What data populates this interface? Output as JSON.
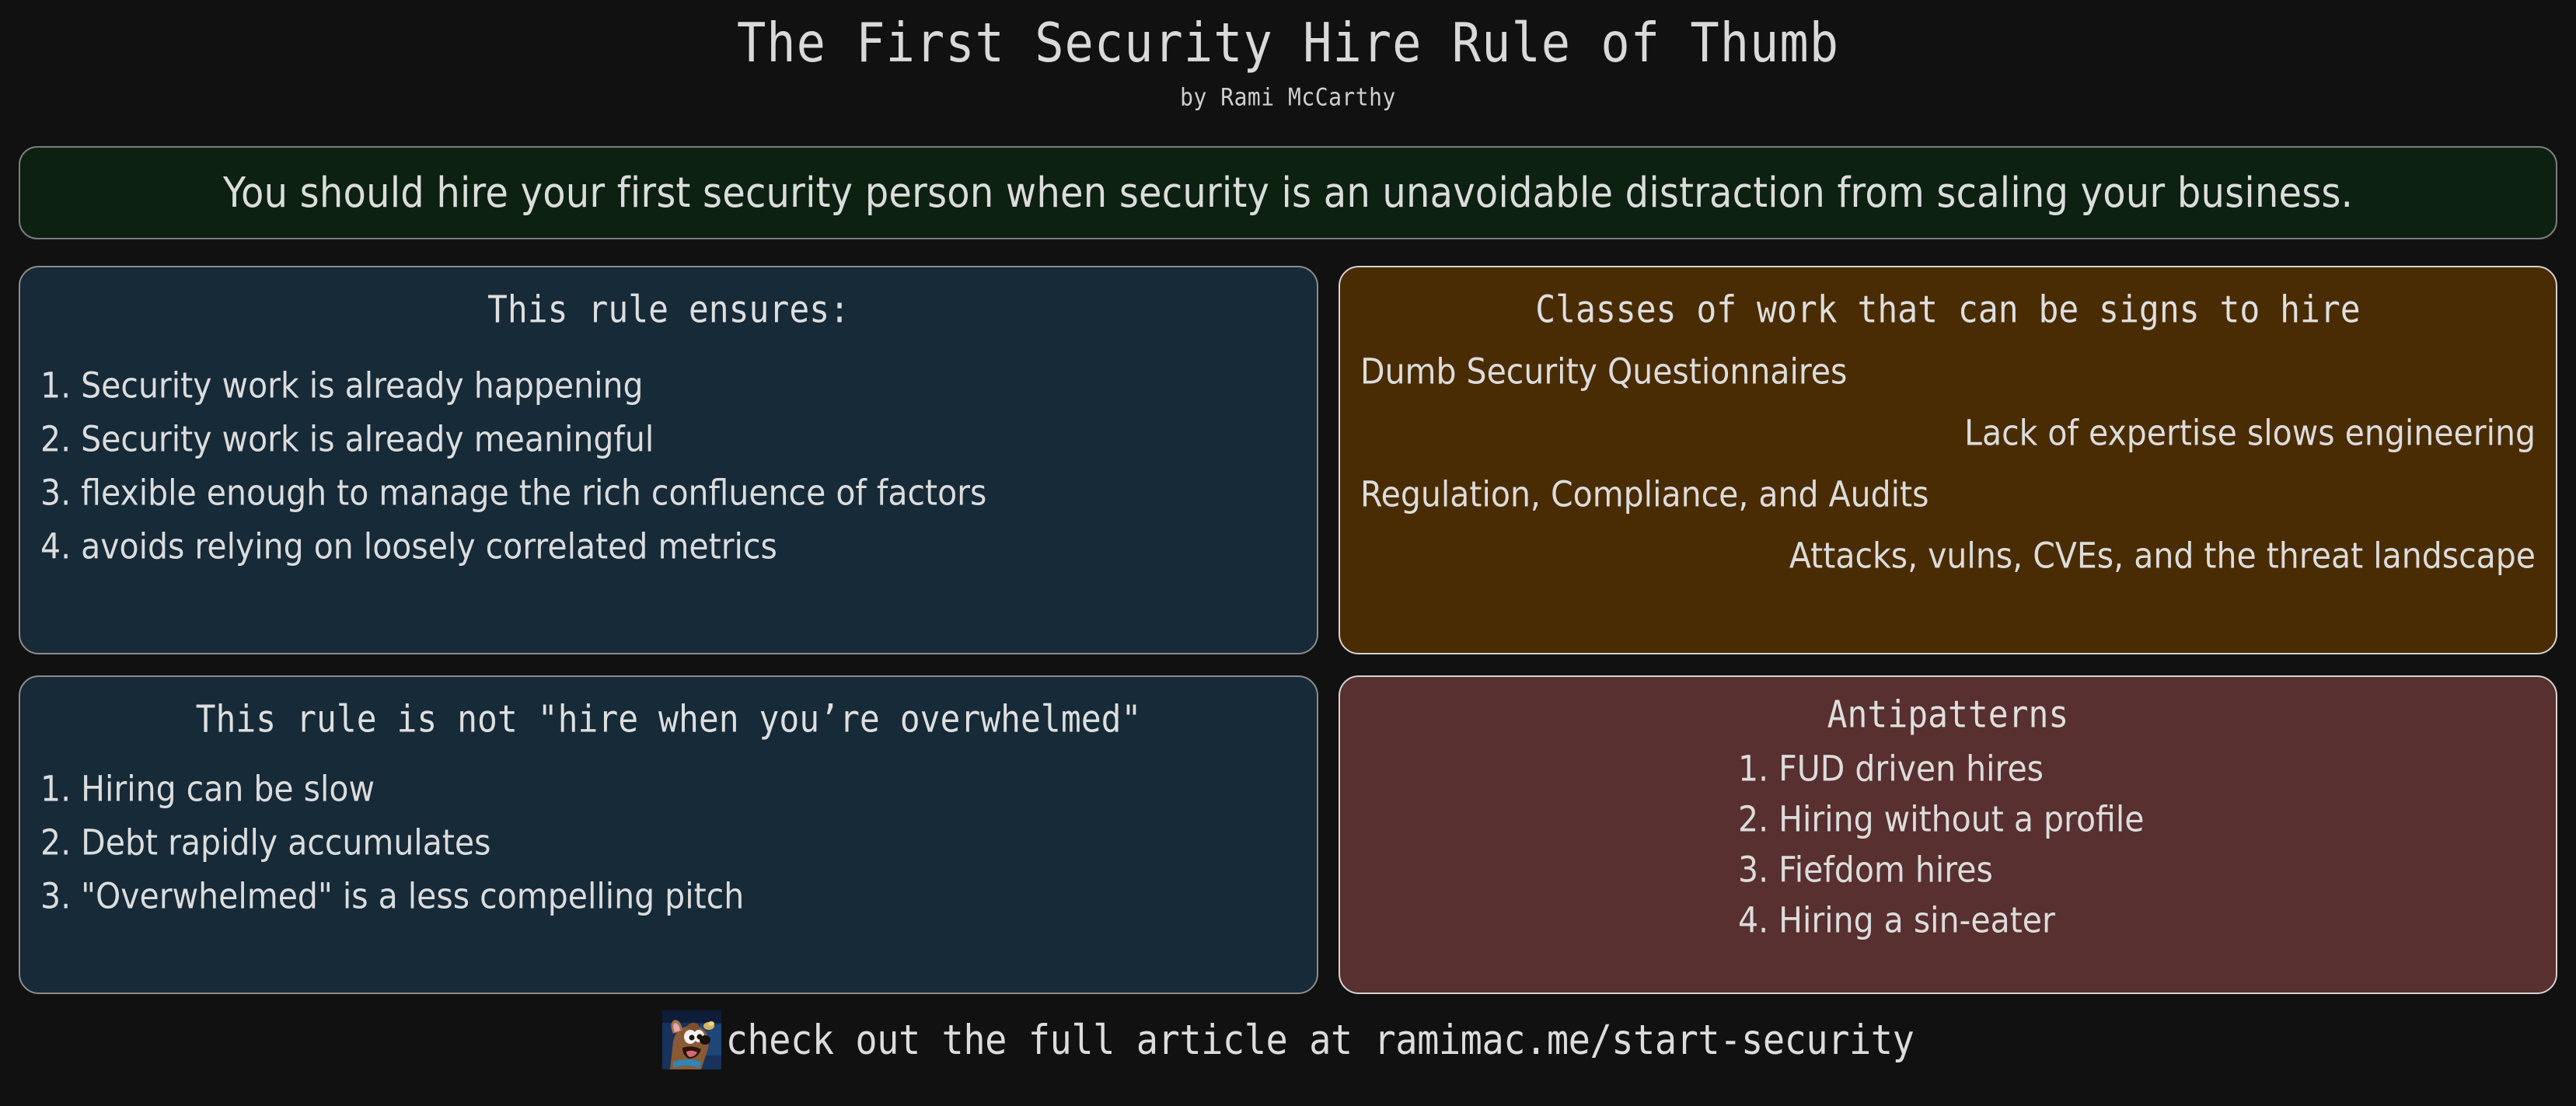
{
  "header": {
    "title": "The First Security Hire Rule of Thumb",
    "byline": "by Rami McCarthy"
  },
  "banner": {
    "text": "You should hire your first security person when security is an unavoidable distraction from scaling your business.",
    "background_color": "#0c2110",
    "border_color": "#7d7d7d"
  },
  "cards": {
    "ensures": {
      "title": "This rule ensures:",
      "background_color": "#162a38",
      "items": [
        "1. Security work is already happening",
        "2. Security work is already meaningful",
        "3. flexible enough to manage the rich confluence of factors",
        "4. avoids relying on loosely correlated metrics"
      ]
    },
    "signs": {
      "title": "Classes of work that can be signs to hire",
      "background_color": "#4a2c04",
      "items": [
        {
          "text": "Dumb Security Questionnaires",
          "align": "left"
        },
        {
          "text": "Lack of expertise slows engineering",
          "align": "right"
        },
        {
          "text": "Regulation, Compliance, and Audits",
          "align": "left"
        },
        {
          "text": "Attacks, vulns, CVEs, and the threat landscape",
          "align": "right"
        }
      ]
    },
    "not": {
      "title": "This rule is not \"hire when you’re overwhelmed\"",
      "background_color": "#162a38",
      "items": [
        "1. Hiring can be slow",
        "2. Debt rapidly accumulates",
        "3. \"Overwhelmed\" is a less compelling pitch"
      ]
    },
    "antipatterns": {
      "title": "Antipatterns",
      "background_color": "#58302f",
      "items": [
        "1. FUD driven hires",
        "2. Hiring without a profile",
        "3. Fiefdom hires",
        "4. Hiring a sin-eater"
      ]
    }
  },
  "footer": {
    "thumbnail_name": "scooby-doo-thumbnail",
    "text": "check out the full article at ramimac.me/start-security"
  },
  "page": {
    "background_color": "#111111",
    "text_color": "#dcdcdc"
  }
}
